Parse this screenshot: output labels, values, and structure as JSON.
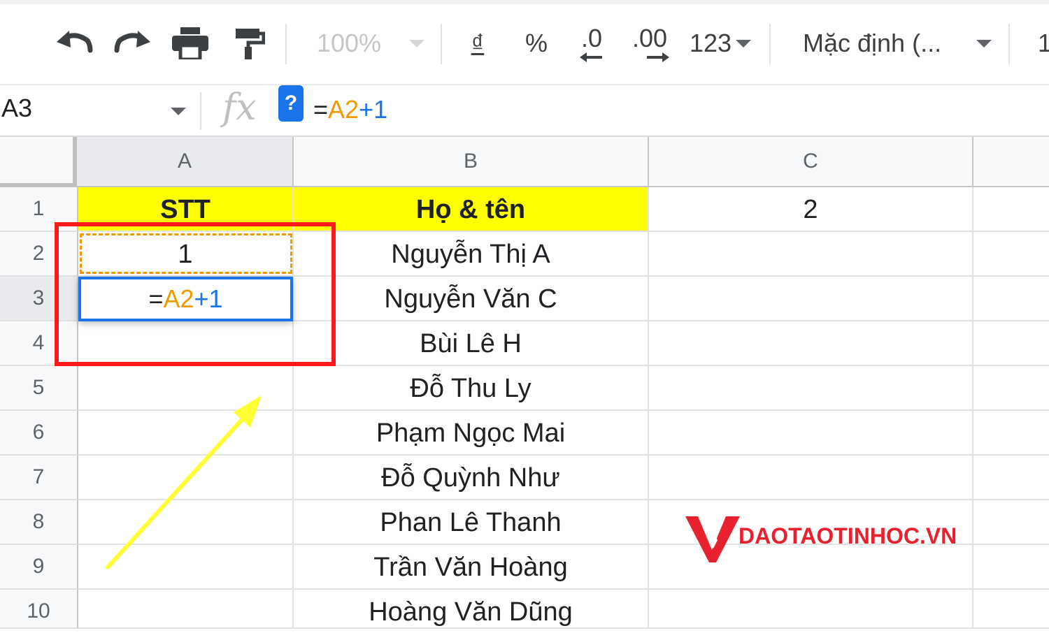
{
  "toolbar": {
    "zoom": "100%",
    "currency_symbol": "₫",
    "percent": "%",
    "decrease_decimal": ".0",
    "increase_decimal": ".00",
    "more_formats": "123",
    "font_name": "Mặc định (...",
    "font_size_partial": "1"
  },
  "formula_bar": {
    "name_box": "A3",
    "fx": "fx",
    "help": "?",
    "formula": {
      "eq": "=",
      "ref": "A2",
      "rest": "+1"
    }
  },
  "columns": [
    "A",
    "B",
    "C"
  ],
  "rows": [
    {
      "num": "1",
      "a": "STT",
      "b": "Họ & tên",
      "c": "2"
    },
    {
      "num": "2",
      "a": "1",
      "b": "Nguyễn Thị A",
      "c": ""
    },
    {
      "num": "3",
      "a": "",
      "b": "Nguyễn Văn C",
      "c": ""
    },
    {
      "num": "4",
      "a": "",
      "b": "Bùi Lê H",
      "c": ""
    },
    {
      "num": "5",
      "a": "",
      "b": "Đỗ Thu Ly",
      "c": ""
    },
    {
      "num": "6",
      "a": "",
      "b": "Phạm Ngọc Mai",
      "c": ""
    },
    {
      "num": "7",
      "a": "",
      "b": "Đỗ Quỳnh Như",
      "c": ""
    },
    {
      "num": "8",
      "a": "",
      "b": "Phan Lê Thanh",
      "c": ""
    },
    {
      "num": "9",
      "a": "",
      "b": "Trần Văn Hoàng",
      "c": ""
    },
    {
      "num": "10",
      "a": "",
      "b": "Hoàng Văn Dũng",
      "c": ""
    }
  ],
  "active_cell": {
    "eq": "=",
    "ref": "A2",
    "rest": "+1"
  },
  "logo": {
    "text": "DAOTAOTINHOC.VN"
  },
  "colors": {
    "header_fill": "#ffff00",
    "selection": "#1a73e8",
    "copy_marquee": "#f29900",
    "highlight_box": "#ff1a1a",
    "arrow": "#ffff33",
    "logo": "#e8212f"
  }
}
